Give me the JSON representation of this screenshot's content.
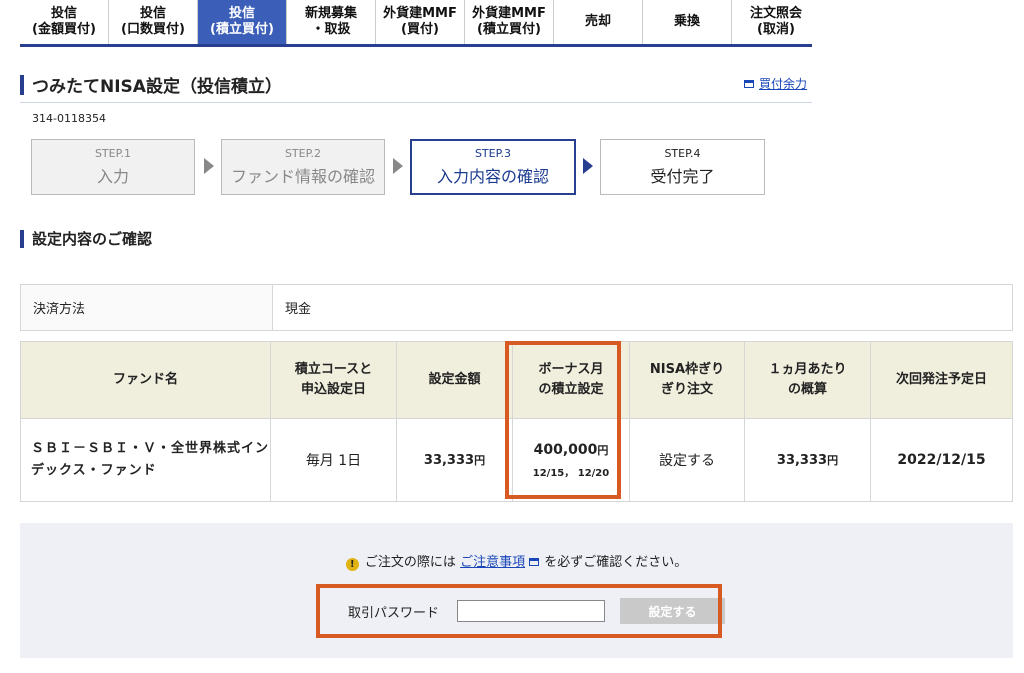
{
  "tabs": [
    {
      "label": "投信\n(金額買付)"
    },
    {
      "label": "投信\n(口数買付)"
    },
    {
      "label": "投信\n(積立買付)"
    },
    {
      "label": "新規募集\n・取扱"
    },
    {
      "label": "外貨建MMF\n(買付)"
    },
    {
      "label": "外貨建MMF\n(積立買付)"
    },
    {
      "label": "売却"
    },
    {
      "label": "乗換"
    },
    {
      "label": "注文照会\n(取消)"
    }
  ],
  "page": {
    "title": "つみたてNISA設定（投信積立）",
    "buying_power_link": "買付余力",
    "account_number": "314-0118354"
  },
  "steps": [
    {
      "num": "STEP.1",
      "label": "入力"
    },
    {
      "num": "STEP.2",
      "label": "ファンド情報の確認"
    },
    {
      "num": "STEP.3",
      "label": "入力内容の確認"
    },
    {
      "num": "STEP.4",
      "label": "受付完了"
    }
  ],
  "section_title": "設定内容のご確認",
  "payment": {
    "label": "決済方法",
    "value": "現金"
  },
  "fund_table": {
    "headers": [
      "ファンド名",
      "積立コースと\n申込設定日",
      "設定金額",
      "ボーナス月\nの積立設定",
      "NISA枠ぎり\nぎり注文",
      "１ヵ月あたり\nの概算",
      "次回発注予定日"
    ],
    "row": {
      "fund_name": "ＳＢＩ－ＳＢＩ・Ｖ・全世界株式インデックス・ファンド",
      "course": "毎月 1日",
      "amount": "33,333",
      "bonus_amount": "400,000",
      "bonus_dates": "12/15， 12/20",
      "nisa_max": "設定する",
      "monthly_estimate": "33,333",
      "next_order_date": "2022/12/15",
      "yen_unit": "円"
    }
  },
  "confirm": {
    "notice_pre": "ご注文の際には",
    "notice_link": "ご注意事項",
    "notice_post": "を必ずご確認ください。",
    "password_label": "取引パスワード",
    "submit_label": "設定する"
  },
  "colors": {
    "accent": "#283e8e",
    "active_tab": "#3b5fb9",
    "highlight": "#d65a22",
    "table_header": "#f0efde"
  }
}
